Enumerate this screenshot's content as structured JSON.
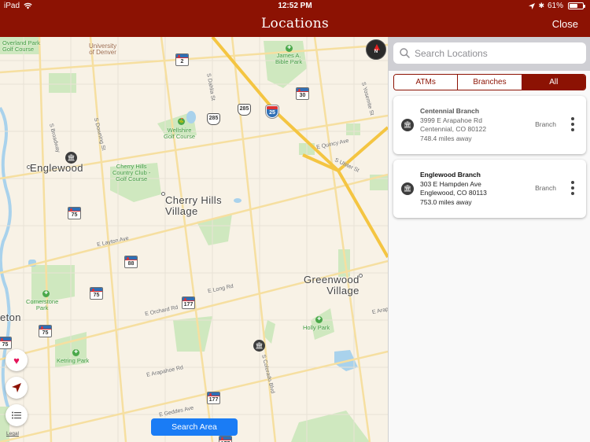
{
  "status_bar": {
    "device": "iPad",
    "time": "12:52 PM",
    "battery": "61%",
    "battery_level": 0.61
  },
  "nav": {
    "title": "Locations",
    "close_label": "Close"
  },
  "map": {
    "cities": [
      {
        "id": "englewood",
        "label": "Englewood"
      },
      {
        "id": "cherry-hills",
        "label": "Cherry Hills\nVillage"
      },
      {
        "id": "greenwood",
        "label": "Greenwood\nVillage"
      },
      {
        "id": "littleton",
        "label": "eton"
      }
    ],
    "parks": [
      {
        "id": "overland",
        "label": "Overland Park\nGolf Course"
      },
      {
        "id": "james-bible",
        "label": "James A.\nBible Park"
      },
      {
        "id": "wellshire",
        "label": "Wellshire\nGolf Course"
      },
      {
        "id": "cherry-hills-cc",
        "label": "Cherry Hills\nCountry Club -\nGolf Course"
      },
      {
        "id": "cornerstone",
        "label": "Cornerstone\nPark"
      },
      {
        "id": "holly",
        "label": "Holly Park"
      },
      {
        "id": "ketring",
        "label": "Ketring Park"
      }
    ],
    "pois": [
      {
        "id": "univ-denver",
        "label": "University\nof Denver"
      }
    ],
    "streets": [
      {
        "id": "s-dahlia",
        "label": "S Dahlia St"
      },
      {
        "id": "s-yosemite",
        "label": "S Yosemite St"
      },
      {
        "id": "s-broadway",
        "label": "S Broadway"
      },
      {
        "id": "s-downing",
        "label": "S Downing St"
      },
      {
        "id": "e-quincy",
        "label": "E Quincy Ave"
      },
      {
        "id": "s-ulster",
        "label": "S Ulster St"
      },
      {
        "id": "e-layton",
        "label": "E Layton Ave"
      },
      {
        "id": "e-orchard",
        "label": "E Orchard Rd"
      },
      {
        "id": "e-long",
        "label": "E Long Rd"
      },
      {
        "id": "e-arapahoe-1",
        "label": "E Arapahoe Rd"
      },
      {
        "id": "e-arapahoe-2",
        "label": "E Arap"
      },
      {
        "id": "s-colorado",
        "label": "S Colorado Blvd"
      },
      {
        "id": "e-geddes",
        "label": "E Geddes Ave"
      }
    ],
    "highway_shields": {
      "co_2": "2",
      "us_285_a": "285",
      "us_285_b": "285",
      "i_25": "25",
      "co_30": "30",
      "co_75_a": "75",
      "co_75_b": "75",
      "co_75_c": "75",
      "co_75_d": "75",
      "co_88": "88",
      "co_177_a": "177",
      "co_177_b": "177",
      "co_177_c": "177"
    },
    "compass_label": "N",
    "legal_label": "Legal",
    "search_area_label": "Search Area",
    "bank_glyph": "🏛"
  },
  "panel": {
    "search": {
      "placeholder": "Search Locations",
      "value": ""
    },
    "filters": [
      {
        "label": "ATMs",
        "active": false
      },
      {
        "label": "Branches",
        "active": false
      },
      {
        "label": "All",
        "active": true
      }
    ],
    "locations": [
      {
        "name": "Centennial Branch",
        "address1": "3999 E Arapahoe Rd",
        "address2": "Centennial, CO 80122",
        "distance": "748.4 miles away",
        "type": "Branch",
        "selected": false
      },
      {
        "name": "Englewood Branch",
        "address1": "303 E Hampden Ave",
        "address2": "Englewood, CO 80113",
        "distance": "753.0 miles away",
        "type": "Branch",
        "selected": true
      }
    ]
  },
  "colors": {
    "brand": "#8c1203",
    "search_area_button": "#1a7cf5",
    "heart": "#e4145a",
    "map_background": "#f8f2e6",
    "park": "#c7e6b4",
    "highway": "#f5c542"
  }
}
